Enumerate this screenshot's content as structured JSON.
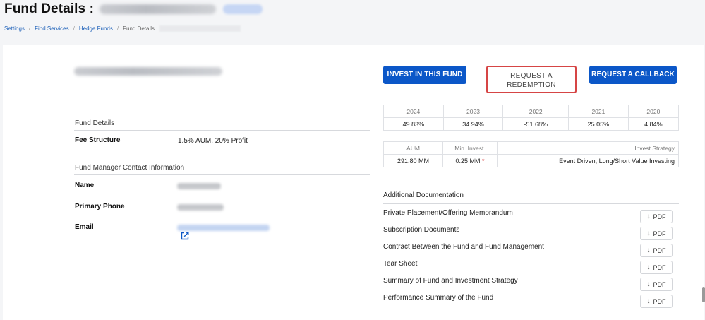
{
  "header": {
    "title": "Fund Details :"
  },
  "breadcrumb": {
    "items": [
      "Settings",
      "Find Services",
      "Hedge Funds",
      "Fund Details :"
    ]
  },
  "actions": {
    "invest": "INVEST IN THIS FUND",
    "redeem_line1": "REQUEST A",
    "redeem_line2": "REDEMPTION",
    "callback": "REQUEST A CALLBACK"
  },
  "fund_details": {
    "heading": "Fund Details",
    "fee_label": "Fee Structure",
    "fee_value": "1.5% AUM, 20% Profit"
  },
  "contact": {
    "heading": "Fund Manager Contact Information",
    "name_label": "Name",
    "phone_label": "Primary Phone",
    "email_label": "Email"
  },
  "performance": {
    "years": [
      "2024",
      "2023",
      "2022",
      "2021",
      "2020"
    ],
    "returns": [
      "49.83%",
      "34.94%",
      "-51.68%",
      "25.05%",
      "4.84%"
    ]
  },
  "stats": {
    "aum_label": "AUM",
    "min_label": "Min. Invest.",
    "strategy_label": "Invest Strategy",
    "aum_value": "291.80 MM",
    "min_value": "0.25 MM",
    "min_marker": "*",
    "strategy_value": "Event Driven, Long/Short Value Investing"
  },
  "documents": {
    "heading": "Additional Documentation",
    "pdf_label": "PDF",
    "items": [
      "Private Placement/Offering Memorandum",
      "Subscription Documents",
      "Contract Between the Fund and Fund Management",
      "Tear Sheet",
      "Summary of Fund and Investment Strategy",
      "Performance Summary of the Fund"
    ]
  },
  "colors": {
    "primary": "#0b57c8",
    "highlight_border": "#d64545"
  }
}
